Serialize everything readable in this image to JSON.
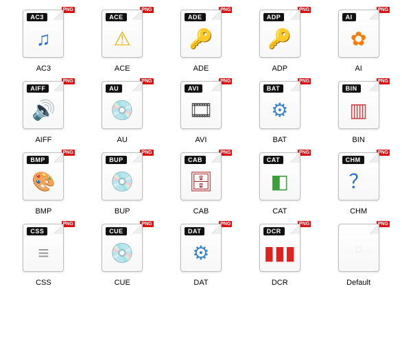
{
  "badge_text": "PNG",
  "items": [
    {
      "ext": "AC3",
      "caption": "AC3",
      "glyph": "♫",
      "color": "#2a6bd4"
    },
    {
      "ext": "ACE",
      "caption": "ACE",
      "glyph": "⚠",
      "color": "#e6b400"
    },
    {
      "ext": "ADE",
      "caption": "ADE",
      "glyph": "🔑",
      "color": "#8a1a3a"
    },
    {
      "ext": "ADP",
      "caption": "ADP",
      "glyph": "🔑",
      "color": "#8a1a3a"
    },
    {
      "ext": "AI",
      "caption": "AI",
      "glyph": "✿",
      "color": "#ff7a00"
    },
    {
      "ext": "AIFF",
      "caption": "AIFF",
      "glyph": "🔊",
      "color": "#6b7c8a"
    },
    {
      "ext": "AU",
      "caption": "AU",
      "glyph": "💿",
      "color": "#3aa0d8"
    },
    {
      "ext": "AVI",
      "caption": "AVI",
      "glyph": "🎞",
      "color": "#444"
    },
    {
      "ext": "BAT",
      "caption": "BAT",
      "glyph": "⚙",
      "color": "#3a86c8"
    },
    {
      "ext": "BIN",
      "caption": "BIN",
      "glyph": "▥",
      "color": "#c44"
    },
    {
      "ext": "BMP",
      "caption": "BMP",
      "glyph": "🎨",
      "color": "#c0504d"
    },
    {
      "ext": "BUP",
      "caption": "BUP",
      "glyph": "💿",
      "color": "#8aa"
    },
    {
      "ext": "CAB",
      "caption": "CAB",
      "glyph": "🗄",
      "color": "#b03030"
    },
    {
      "ext": "CAT",
      "caption": "CAT",
      "glyph": "◧",
      "color": "#3aa03a"
    },
    {
      "ext": "CHM",
      "caption": "CHM",
      "glyph": "？",
      "color": "#2a6bd4"
    },
    {
      "ext": "CSS",
      "caption": "CSS",
      "glyph": "≡",
      "color": "#999"
    },
    {
      "ext": "CUE",
      "caption": "CUE",
      "glyph": "💿",
      "color": "#8aa"
    },
    {
      "ext": "DAT",
      "caption": "DAT",
      "glyph": "⚙",
      "color": "#3a86c8"
    },
    {
      "ext": "DCR",
      "caption": "DCR",
      "glyph": "▮▮▮",
      "color": "#d22"
    },
    {
      "ext": "",
      "caption": "Default",
      "glyph": "▫",
      "color": "#eee",
      "blank": true
    }
  ]
}
